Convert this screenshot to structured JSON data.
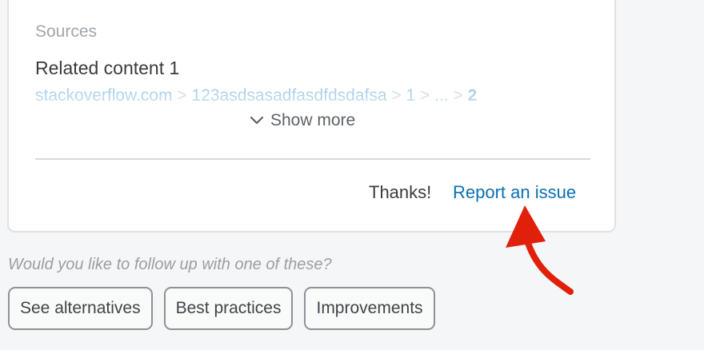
{
  "sources": {
    "label": "Sources",
    "items": [
      {
        "title": "Related content 1",
        "breadcrumb": {
          "domain": "stackoverflow.com",
          "path_1": "123asdsasadfasdfdsdafsa",
          "path_2": "1",
          "ellipsis": "...",
          "page": "2",
          "separator": ">"
        }
      }
    ],
    "show_more_label": "Show more",
    "show_more_icon": "chevron-down-icon"
  },
  "feedback": {
    "thanks_text": "Thanks!",
    "report_link_label": "Report an issue"
  },
  "annotation": {
    "arrow_color": "#e0200a"
  },
  "followup": {
    "prompt": "Would you like to follow up with one of these?",
    "suggestions": [
      "See alternatives",
      "Best practices",
      "Improvements"
    ]
  },
  "colors": {
    "link": "#0a6fb4",
    "text": "#3b3b3b",
    "muted": "#a1a5aa"
  }
}
